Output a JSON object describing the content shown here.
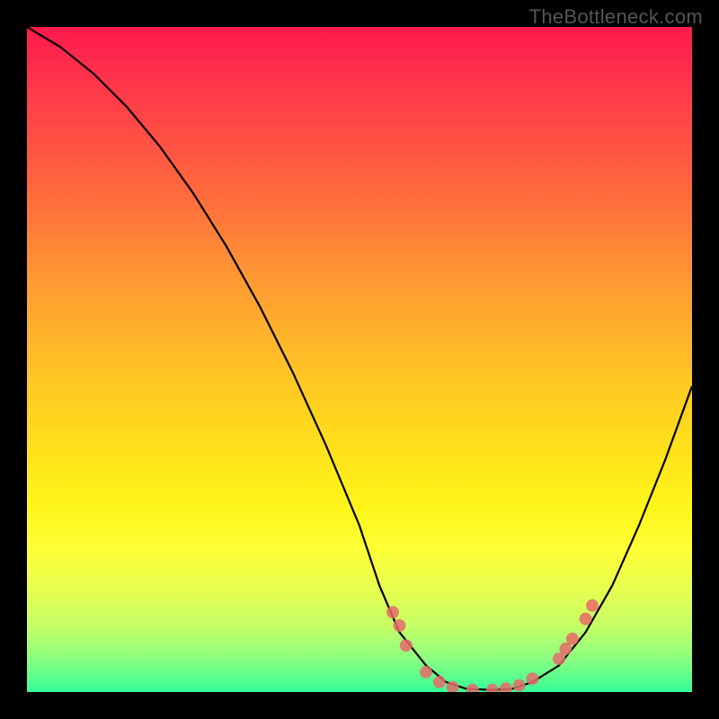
{
  "watermark": "TheBottleneck.com",
  "chart_data": {
    "type": "line",
    "title": "",
    "xlabel": "",
    "ylabel": "",
    "xlim": [
      0,
      100
    ],
    "ylim": [
      0,
      100
    ],
    "series": [
      {
        "name": "curve",
        "x": [
          0,
          5,
          10,
          15,
          20,
          25,
          30,
          35,
          40,
          45,
          50,
          53,
          56,
          60,
          63,
          66,
          70,
          73,
          76,
          80,
          84,
          88,
          92,
          96,
          100
        ],
        "y": [
          100,
          97,
          93,
          88,
          82,
          75,
          67,
          58,
          48,
          37,
          25,
          16,
          9,
          4,
          1.5,
          0.5,
          0.3,
          0.5,
          1.5,
          4,
          9,
          16,
          25,
          35,
          46
        ]
      }
    ],
    "markers": [
      {
        "x": 55,
        "y": 12
      },
      {
        "x": 56,
        "y": 10
      },
      {
        "x": 57,
        "y": 7
      },
      {
        "x": 60,
        "y": 3
      },
      {
        "x": 62,
        "y": 1.5
      },
      {
        "x": 64,
        "y": 0.7
      },
      {
        "x": 67,
        "y": 0.3
      },
      {
        "x": 70,
        "y": 0.3
      },
      {
        "x": 72,
        "y": 0.5
      },
      {
        "x": 74,
        "y": 1
      },
      {
        "x": 76,
        "y": 2
      },
      {
        "x": 80,
        "y": 5
      },
      {
        "x": 81,
        "y": 6.5
      },
      {
        "x": 82,
        "y": 8
      },
      {
        "x": 84,
        "y": 11
      },
      {
        "x": 85,
        "y": 13
      }
    ],
    "background_gradient": {
      "top": "#ff1a4d",
      "bottom": "#33ff99"
    }
  }
}
